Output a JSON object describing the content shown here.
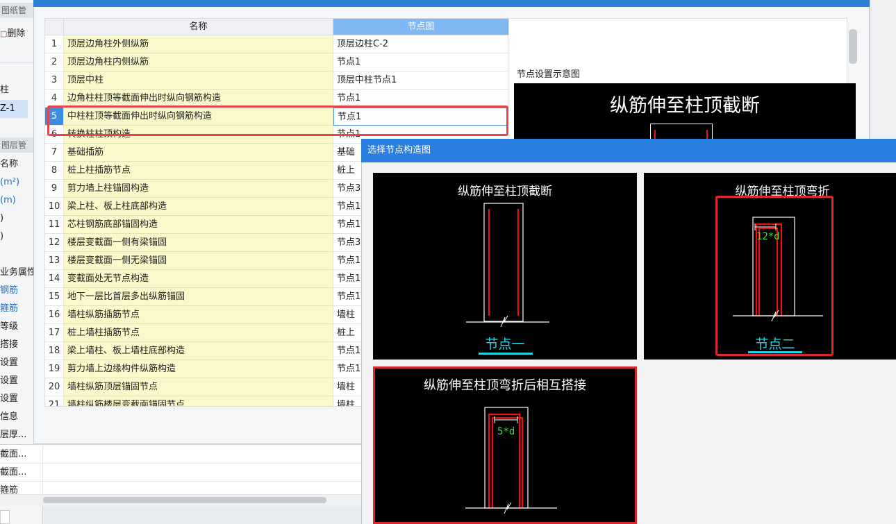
{
  "left_panel": {
    "header1": "图纸管",
    "delete_label": "删除",
    "items": [
      "柱",
      "Z-1"
    ],
    "header2": "图层管",
    "layer_rows": [
      "名称",
      "(m²)",
      "(m)",
      ")",
      ")"
    ],
    "prop_rows": [
      "业务属性",
      "钢筋",
      "箍筋",
      "等级",
      "搭接",
      "设置",
      "设置",
      "设置",
      "信息",
      "层厚...",
      "截面...",
      "截面...",
      "箍筋"
    ]
  },
  "grid": {
    "col_name": "名称",
    "col_node": "节点图",
    "rows": [
      {
        "idx": "1",
        "name": "顶层边角柱外侧纵筋",
        "node": "顶层边柱C-2"
      },
      {
        "idx": "2",
        "name": "顶层边角柱内侧纵筋",
        "node": "节点1"
      },
      {
        "idx": "3",
        "name": "顶层中柱",
        "node": "顶层中柱节点1"
      },
      {
        "idx": "4",
        "name": "边角柱柱顶等截面伸出时纵向钢筋构造",
        "node": "节点1"
      },
      {
        "idx": "5",
        "name": "中柱柱顶等截面伸出时纵向钢筋构造",
        "node": "节点1"
      },
      {
        "idx": "6",
        "name": "转换柱柱顶构造",
        "node": "节点1"
      },
      {
        "idx": "7",
        "name": "基础插筋",
        "node": "基础"
      },
      {
        "idx": "8",
        "name": "桩上柱插筋节点",
        "node": "桩上"
      },
      {
        "idx": "9",
        "name": "剪力墙上柱锚固构造",
        "node": "节点3"
      },
      {
        "idx": "10",
        "name": "梁上柱、板上柱底部构造",
        "node": "节点1"
      },
      {
        "idx": "11",
        "name": "芯柱钢筋底部锚固构造",
        "node": "节点1"
      },
      {
        "idx": "12",
        "name": "楼层变截面一侧有梁锚固",
        "node": "节点3"
      },
      {
        "idx": "13",
        "name": "楼层变截面一侧无梁锚固",
        "node": "节点1"
      },
      {
        "idx": "14",
        "name": "变截面处无节点构造",
        "node": "节点1"
      },
      {
        "idx": "15",
        "name": "地下一层比首层多出纵筋锚固",
        "node": "节点1"
      },
      {
        "idx": "16",
        "name": "墙柱纵筋插筋节点",
        "node": "墙柱"
      },
      {
        "idx": "17",
        "name": "桩上墙柱插筋节点",
        "node": "桩上"
      },
      {
        "idx": "18",
        "name": "梁上墙柱、板上墙柱底部构造",
        "node": "节点1"
      },
      {
        "idx": "19",
        "name": "剪力墙上边缘构件纵筋构造",
        "node": "节点1"
      },
      {
        "idx": "20",
        "name": "墙柱纵筋顶层锚固节点",
        "node": "墙柱"
      },
      {
        "idx": "21",
        "name": "墙柱纵筋楼层变截面锚固节点",
        "node": "墙柱"
      }
    ],
    "ellipsis": "···"
  },
  "preview": {
    "label": "节点设置示意图",
    "title": "纵筋伸至柱顶截断"
  },
  "select_dialog": {
    "title": "选择节点构造图",
    "tiles": [
      {
        "title": "纵筋伸至柱顶截断",
        "caption": "节点一"
      },
      {
        "title": "纵筋伸至柱顶弯折",
        "caption": "节点二",
        "dim": "12*d"
      },
      {
        "title": "纵筋伸至柱顶弯折后相互搭接",
        "dim": "5*d"
      }
    ]
  },
  "colors": {
    "accent_blue": "#2b7fe0",
    "highlight_red": "#e0464e",
    "name_cell_yellow": "#fbf8cc",
    "caption_cyan": "#22d3e6"
  }
}
